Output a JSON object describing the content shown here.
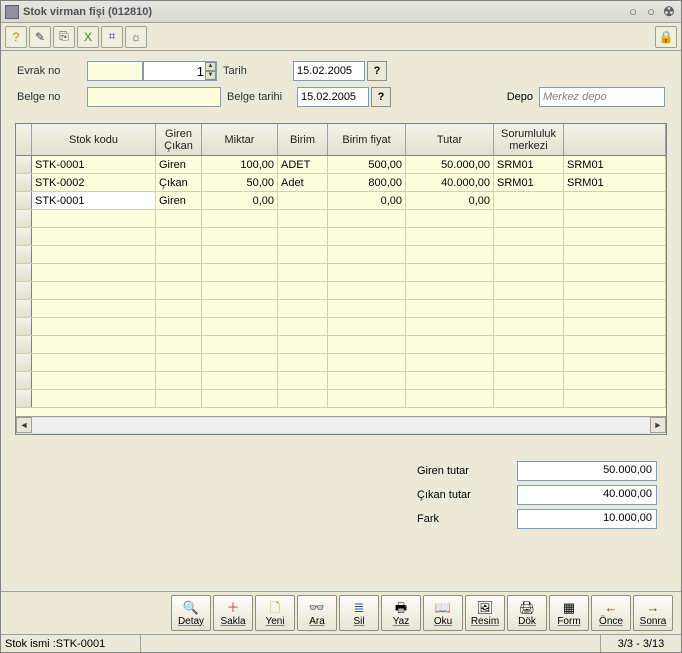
{
  "title": "Stok virman fişi (012810)",
  "toolbar_icons": [
    "?",
    "✎",
    "⎘",
    "X",
    "⌗",
    "☼"
  ],
  "form": {
    "evrak_label": "Evrak no",
    "evrak_text": "",
    "evrak_num": "1",
    "tarih_label": "Tarih",
    "tarih_value": "15.02.2005",
    "belge_label": "Belge no",
    "belge_value": "",
    "belge_tarih_label": "Belge tarihi",
    "belge_tarih_value": "15.02.2005",
    "depo_label": "Depo",
    "depo_value": "Merkez depo"
  },
  "grid": {
    "headers": [
      "Stok kodu",
      "Giren\nÇıkan",
      "Miktar",
      "Birim",
      "Birim fiyat",
      "Tutar",
      "Sorumluluk\nmerkezi",
      ""
    ],
    "rows": [
      {
        "stok": "STK-0001",
        "gc": "Giren",
        "miktar": "100,00",
        "birim": "ADET",
        "bf": "500,00",
        "tutar": "50.000,00",
        "sm": "SRM01",
        "ex": "SRM01",
        "active": false
      },
      {
        "stok": "STK-0002",
        "gc": "Çıkan",
        "miktar": "50,00",
        "birim": "Adet",
        "bf": "800,00",
        "tutar": "40.000,00",
        "sm": "SRM01",
        "ex": "SRM01",
        "active": false
      },
      {
        "stok": "STK-0001",
        "gc": "Giren",
        "miktar": "0,00",
        "birim": "",
        "bf": "0,00",
        "tutar": "0,00",
        "sm": "",
        "ex": "",
        "active": true
      }
    ]
  },
  "totals": {
    "giren_label": "Giren tutar",
    "giren_value": "50.000,00",
    "cikan_label": "Çıkan tutar",
    "cikan_value": "40.000,00",
    "fark_label": "Fark",
    "fark_value": "10.000,00"
  },
  "buttons": [
    {
      "icon": "🔍",
      "label": "Detay"
    },
    {
      "icon": "＋",
      "label": "Sakla",
      "color": "#C04040"
    },
    {
      "icon": "🗋",
      "label": "Yeni",
      "color": "#C0A000"
    },
    {
      "icon": "👓",
      "label": "Ara"
    },
    {
      "icon": "≣",
      "label": "Sil",
      "color": "#3050B0"
    },
    {
      "icon": "🖶",
      "label": "Yaz"
    },
    {
      "icon": "📖",
      "label": "Oku"
    },
    {
      "icon": "🖼",
      "label": "Resim"
    },
    {
      "icon": "🖨",
      "label": "Dök"
    },
    {
      "icon": "▦",
      "label": "Form"
    },
    {
      "icon": "←",
      "label": "Önce",
      "color": "#C02020"
    },
    {
      "icon": "→",
      "label": "Sonra",
      "color": "#C02020"
    }
  ],
  "status": {
    "left": "Stok ismi :STK-0001",
    "right": "3/3 - 3/13"
  }
}
